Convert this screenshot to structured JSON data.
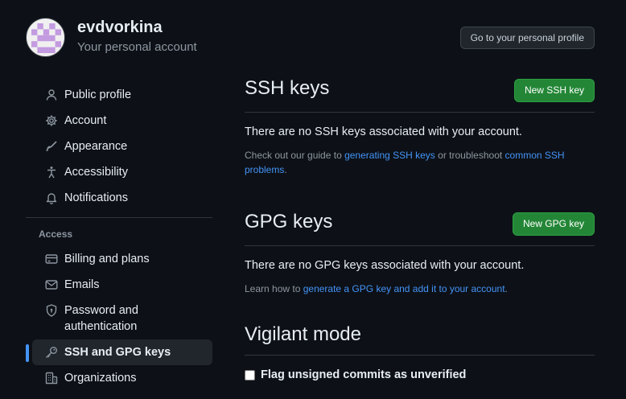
{
  "account": {
    "username": "evdvorkina",
    "subtitle": "Your personal account",
    "profile_button": "Go to your personal profile"
  },
  "sidebar": {
    "items": [
      {
        "label": "Public profile",
        "icon": "person-icon"
      },
      {
        "label": "Account",
        "icon": "gear-icon"
      },
      {
        "label": "Appearance",
        "icon": "paintbrush-icon"
      },
      {
        "label": "Accessibility",
        "icon": "accessibility-icon"
      },
      {
        "label": "Notifications",
        "icon": "bell-icon"
      }
    ],
    "access_label": "Access",
    "access_items": [
      {
        "label": "Billing and plans",
        "icon": "credit-card-icon"
      },
      {
        "label": "Emails",
        "icon": "mail-icon"
      },
      {
        "label": "Password and authentication",
        "icon": "shield-lock-icon"
      },
      {
        "label": "SSH and GPG keys",
        "icon": "key-icon",
        "active": true
      },
      {
        "label": "Organizations",
        "icon": "organization-icon"
      }
    ]
  },
  "ssh": {
    "title": "SSH keys",
    "button": "New SSH key",
    "empty": "There are no SSH keys associated with your account.",
    "help_prefix": "Check out our guide to ",
    "help_link1": "generating SSH keys",
    "help_middle": " or troubleshoot ",
    "help_link2": "common SSH problems",
    "help_suffix": "."
  },
  "gpg": {
    "title": "GPG keys",
    "button": "New GPG key",
    "empty": "There are no GPG keys associated with your account.",
    "help_prefix": "Learn how to ",
    "help_link": "generate a GPG key and add it to your account",
    "help_suffix": "."
  },
  "vigilant": {
    "title": "Vigilant mode",
    "checkbox_label": "Flag unsigned commits as unverified",
    "checked": false
  },
  "colors": {
    "background": "#0d1117",
    "accent": "#4493f8",
    "green_button": "#238636",
    "avatar_purple": "#c39be0"
  }
}
